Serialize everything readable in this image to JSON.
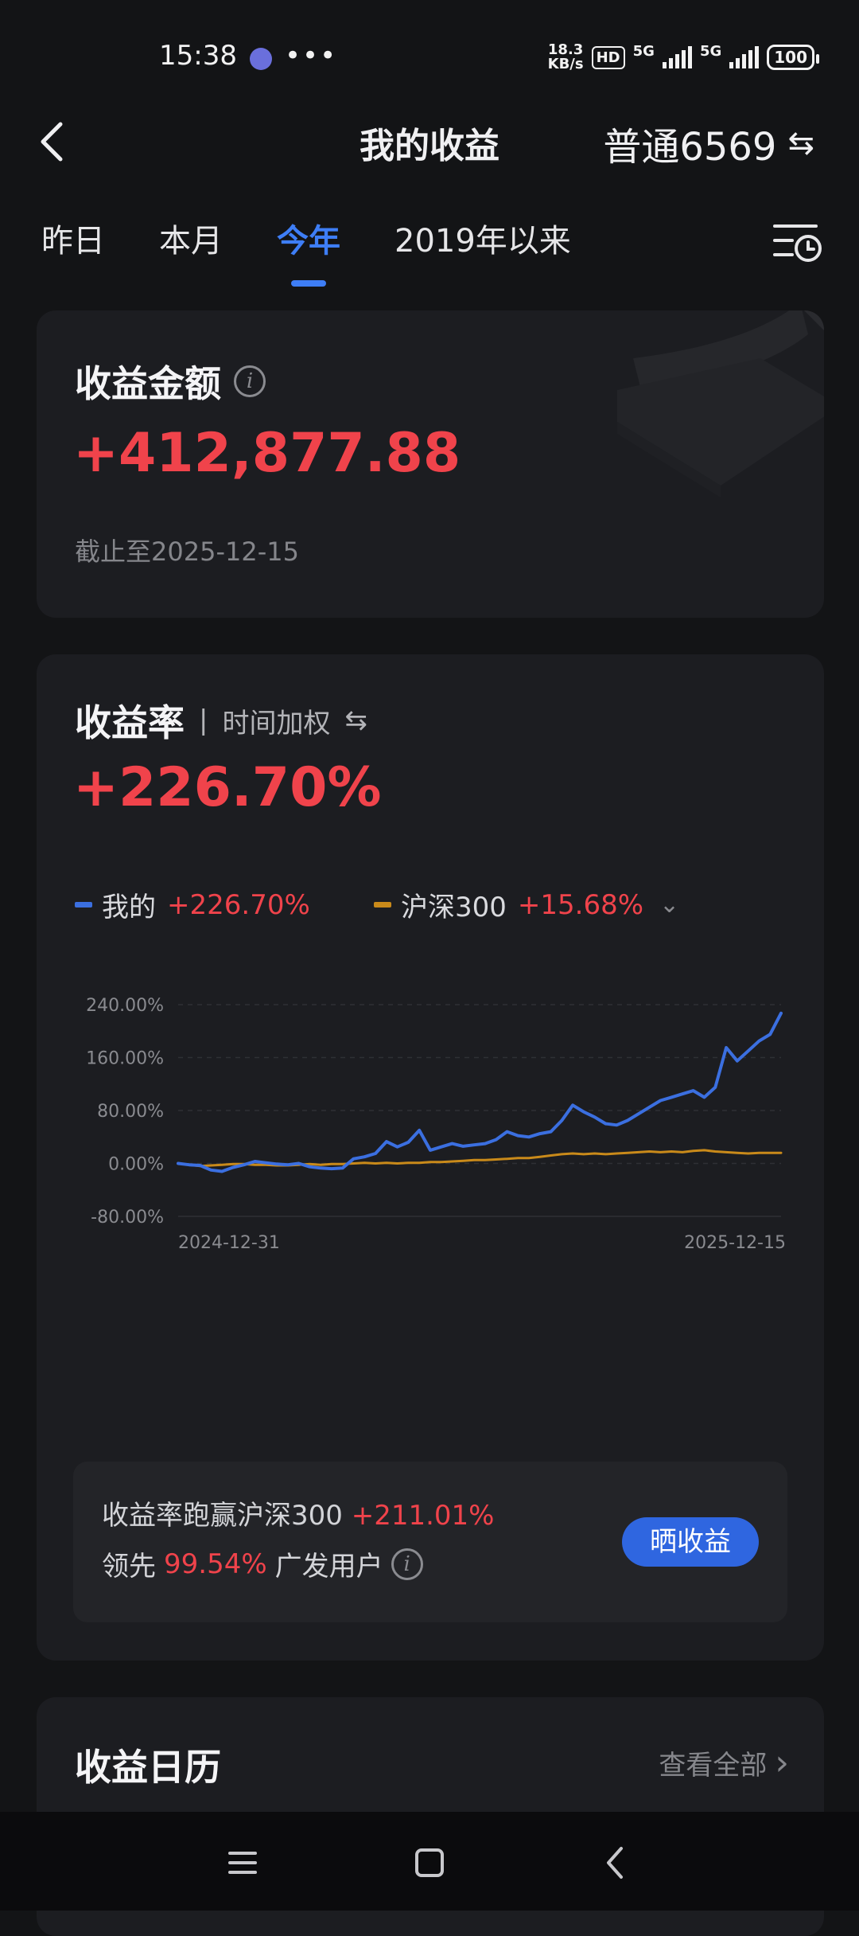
{
  "status": {
    "time": "15:38",
    "more": "•••",
    "net_speed_value": "18.3",
    "net_speed_unit": "KB/s",
    "hd": "HD",
    "sim1": "5G",
    "sim2": "5G",
    "battery": "100"
  },
  "header": {
    "title": "我的收益",
    "account": "普通6569",
    "swap_glyph": "⇆"
  },
  "tabs": [
    {
      "label": "昨日"
    },
    {
      "label": "本月"
    },
    {
      "label": "今年",
      "active": true
    },
    {
      "label": "2019年以来"
    }
  ],
  "earnings": {
    "title": "收益金额",
    "amount": "+412,877.88",
    "as_of": "截止至2025-12-15"
  },
  "rate": {
    "title": "收益率",
    "sep": "|",
    "method": "时间加权",
    "method_swap": "⇆",
    "value": "+226.70%",
    "legend_mine_label": "我的",
    "legend_mine_value": "+226.70%",
    "legend_bench_label": "沪深300",
    "legend_bench_value": "+15.68%",
    "legend_chevron": "⌄"
  },
  "chart_data": {
    "type": "line",
    "y_tick_labels": [
      "240.00%",
      "160.00%",
      "80.00%",
      "0.00%",
      "-80.00%"
    ],
    "ylim": [
      -80,
      240
    ],
    "x_tick_labels": [
      "2024-12-31",
      "2025-12-15"
    ],
    "series": [
      {
        "name": "我的",
        "color": "#3b6fe0",
        "values": [
          0,
          -2,
          -3,
          -10,
          -12,
          -6,
          -2,
          3,
          1,
          -1,
          -2,
          0,
          -5,
          -7,
          -8,
          -7,
          7,
          10,
          15,
          33,
          25,
          32,
          50,
          20,
          25,
          30,
          26,
          28,
          30,
          36,
          48,
          42,
          40,
          45,
          48,
          65,
          88,
          78,
          70,
          60,
          58,
          65,
          75,
          85,
          95,
          100,
          105,
          110,
          100,
          115,
          175,
          155,
          170,
          185,
          195,
          227
        ]
      },
      {
        "name": "沪深300",
        "color": "#c98a1a",
        "values": [
          0,
          -2,
          -4,
          -3,
          -2,
          -1,
          -1,
          -2,
          -2,
          -3,
          -3,
          -2,
          -1,
          -2,
          -1,
          -1,
          0,
          1,
          0,
          1,
          0,
          1,
          1,
          2,
          2,
          3,
          4,
          5,
          5,
          6,
          7,
          8,
          8,
          10,
          12,
          14,
          15,
          14,
          15,
          14,
          15,
          16,
          17,
          18,
          17,
          18,
          17,
          19,
          20,
          18,
          17,
          16,
          15,
          16,
          16,
          16
        ]
      }
    ]
  },
  "compare": {
    "line1_prefix": "收益率跑赢沪深300",
    "line1_value": "+211.01%",
    "line2_prefix": "领先",
    "line2_value": "99.54%",
    "line2_suffix": "广发用户",
    "share_label": "晒收益"
  },
  "calendar": {
    "title": "收益日历",
    "view_all": "查看全部",
    "chevron": "›"
  },
  "colors": {
    "accent": "#3e7ef6",
    "gain": "#f0434b",
    "benchmark": "#c98a1a"
  }
}
